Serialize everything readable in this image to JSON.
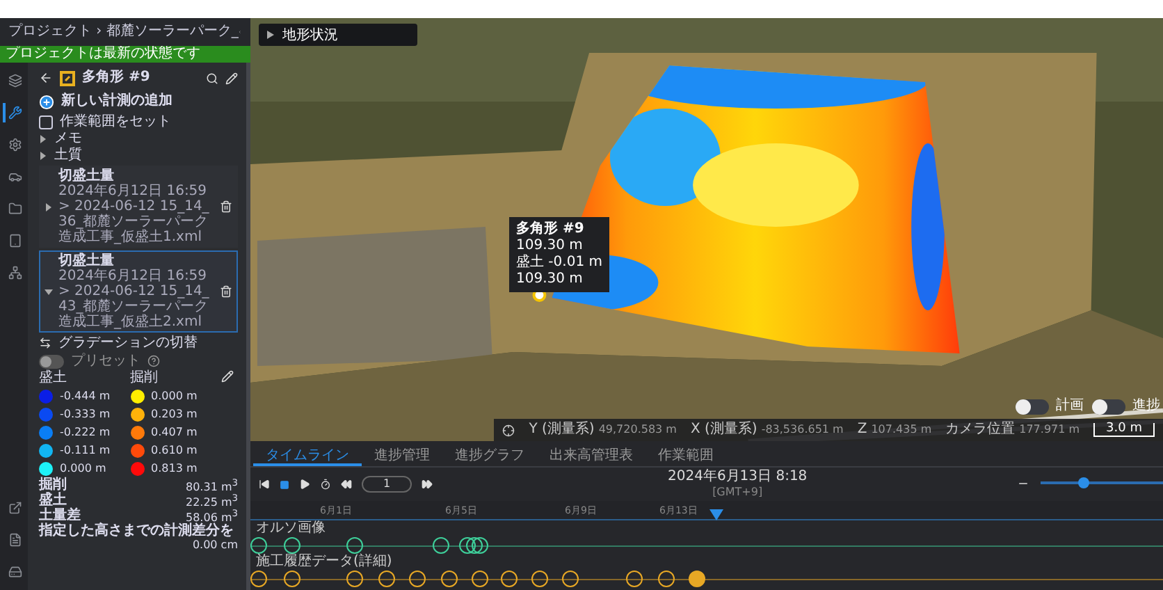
{
  "header": {
    "breadcrumb": "プロジェクト › 都麓ソーラーパーク_",
    "status": "プロジェクトは最新の状態です"
  },
  "rail": {
    "top": [
      {
        "selected": false
      },
      {
        "selected": true
      },
      {
        "selected": false
      },
      {
        "selected": false
      },
      {
        "selected": false
      },
      {
        "selected": false
      },
      {
        "selected": false
      }
    ],
    "bottom": [
      {
        "selected": false
      },
      {
        "selected": false
      },
      {
        "selected": false
      }
    ]
  },
  "object": {
    "title": "多角形 #9"
  },
  "add_measurement": "新しい計測の追加",
  "work_area": {
    "label": "作業範囲をセット",
    "checked": false
  },
  "sections": [
    {
      "label": "メモ",
      "expanded": false
    },
    {
      "label": "土質",
      "expanded": false
    }
  ],
  "measurements": [
    {
      "title": "切盛土量",
      "date": "2024年6月12日 16:59",
      "file": "> 2024-06-12 15_14_36_都麓ソーラーパーク造成工事_仮盛土1.xml",
      "expanded": false,
      "selected": false
    },
    {
      "title": "切盛土量",
      "date": "2024年6月12日 16:59",
      "file": "> 2024-06-12 15_14_43_都麓ソーラーパーク造成工事_仮盛土2.xml",
      "expanded": true,
      "selected": true
    }
  ],
  "gradation": {
    "label": "グラデーションの切替",
    "preset_label": "プリセット",
    "preset_on": false,
    "fill_heading": "盛土",
    "cut_heading": "掘削",
    "fill": [
      {
        "value": "-0.444 m",
        "color": "#0b1ee6"
      },
      {
        "value": "-0.333 m",
        "color": "#0a4af2"
      },
      {
        "value": "-0.222 m",
        "color": "#0a7ef5"
      },
      {
        "value": "-0.111 m",
        "color": "#12b6f2"
      },
      {
        "value": "0.000 m",
        "color": "#1df1f7"
      }
    ],
    "cut": [
      {
        "value": "0.000 m",
        "color": "#ffee00"
      },
      {
        "value": "0.203 m",
        "color": "#ffb20a"
      },
      {
        "value": "0.407 m",
        "color": "#ff7a0a"
      },
      {
        "value": "0.610 m",
        "color": "#ff4a0a"
      },
      {
        "value": "0.813 m",
        "color": "#ff0a0a"
      }
    ]
  },
  "summary": [
    {
      "label": "掘削",
      "value": "80.31 m$^{3}$"
    },
    {
      "label": "盛土",
      "value": "22.25 m$^{3}$"
    },
    {
      "label": "土量差",
      "value": "58.06 m$^{3}$"
    }
  ],
  "difference": {
    "label": "指定した高さまでの計測差分を",
    "value": "0.00 cm"
  },
  "map": {
    "layer_panel": "地形状況",
    "tooltip": {
      "title": "多角形 #9",
      "lines": [
        "109.30 m",
        "盛土 -0.01 m",
        "109.30 m"
      ]
    },
    "toggles": [
      {
        "label": "計画",
        "on": false
      },
      {
        "label": "進捗",
        "on": false
      }
    ],
    "coords": [
      {
        "label": "Y (測量系)",
        "value": "49,720.583 m"
      },
      {
        "label": "X (測量系)",
        "value": "-83,536.651 m"
      },
      {
        "label": "Z",
        "value": "107.435 m"
      },
      {
        "label": "カメラ位置",
        "value": "177.971 m"
      }
    ],
    "scale": "3.0 m"
  },
  "timeline": {
    "tabs": [
      {
        "label": "タイムライン",
        "selected": true
      },
      {
        "label": "進捗管理",
        "selected": false
      },
      {
        "label": "進捗グラフ",
        "selected": false
      },
      {
        "label": "出来高管理表",
        "selected": false
      },
      {
        "label": "作業範囲",
        "selected": false
      }
    ],
    "frame": "1",
    "date": "2024年6月13日 8:18",
    "timezone": "[GMT+9]",
    "zoom": {
      "level": 0.35
    },
    "ticks": [
      "6月1日",
      "6月5日",
      "6月9日",
      "6月13日"
    ],
    "tracks": [
      {
        "label": "オルソ画像",
        "color": "#3ecf9a",
        "events": [
          {
            "selected": false
          },
          {
            "selected": false
          },
          {
            "selected": false
          },
          {
            "selected": false
          },
          {
            "selected": false
          },
          {
            "selected": false
          },
          {
            "selected": false
          }
        ]
      },
      {
        "label": "施工履歴データ(詳細)",
        "color": "#e8a825",
        "events": [
          {
            "selected": false
          },
          {
            "selected": false
          },
          {
            "selected": false
          },
          {
            "selected": false
          },
          {
            "selected": false
          },
          {
            "selected": false
          },
          {
            "selected": false
          },
          {
            "selected": false
          },
          {
            "selected": false
          },
          {
            "selected": false
          },
          {
            "selected": false
          },
          {
            "selected": false
          },
          {
            "selected": true
          }
        ]
      }
    ]
  }
}
